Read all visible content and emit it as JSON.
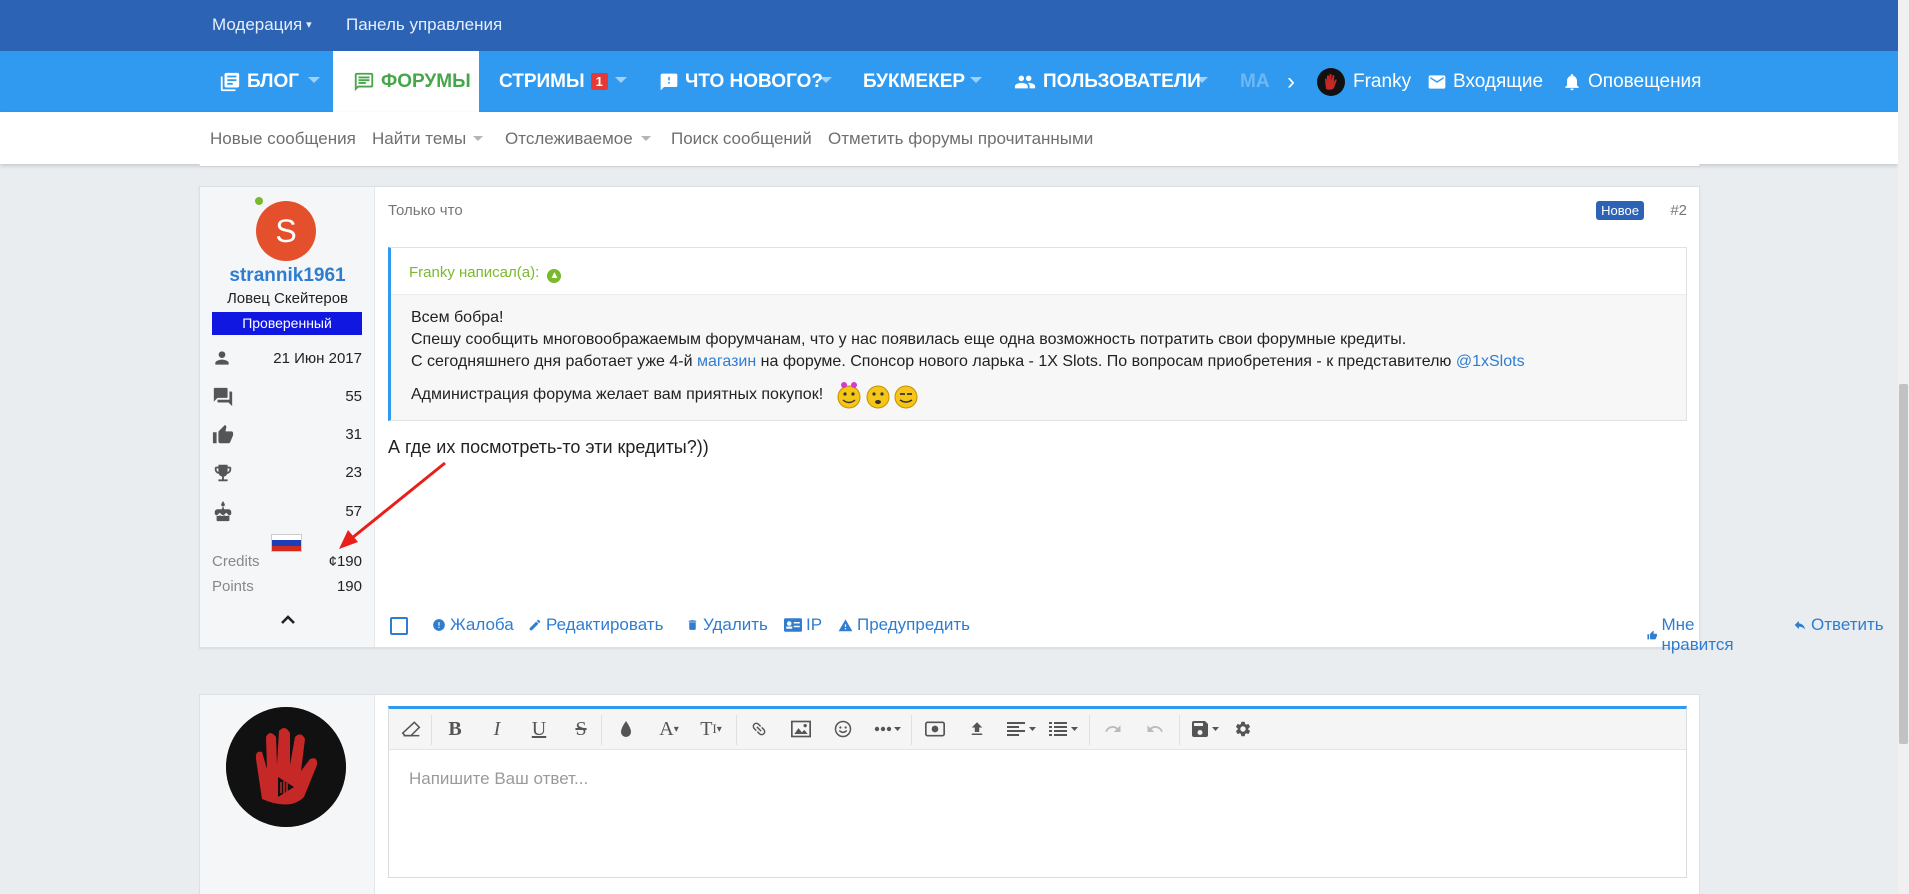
{
  "topbar": {
    "moderation": "Модерация",
    "control_panel": "Панель управления"
  },
  "nav": {
    "blog": "Блог",
    "forums": "Форумы",
    "streams": "Стримы",
    "streams_badge": "1",
    "whats_new": "Что нового?",
    "bookmaker": "Букмекер",
    "users": "Пользователи",
    "more_faded": "МА",
    "chevron": "›",
    "username": "Franky",
    "inbox": "Входящие",
    "alerts": "Оповещения"
  },
  "subnav": {
    "new_posts": "Новые сообщения",
    "find_threads": "Найти темы",
    "watched": "Отслеживаемое",
    "search_posts": "Поиск сообщений",
    "mark_read": "Отметить форумы прочитанными"
  },
  "post": {
    "user": {
      "avatar_letter": "S",
      "name": "strannik1961",
      "title": "Ловец Скейтеров",
      "banner": "Проверенный",
      "joined": "21 Июн 2017",
      "messages": "55",
      "likes": "31",
      "trophies": "23",
      "age": "57",
      "credits_label": "Credits",
      "credits_value": "¢190",
      "points_label": "Points",
      "points_value": "190"
    },
    "time": "Только что",
    "new_label": "Новое",
    "number": "#2",
    "quote": {
      "author": "Franky написал(а):",
      "line1": "Всем бобра!",
      "line2": "Спешу сообщить многовоображаемым форумчанам, что у нас появилась еще одна возможность потратить свои форумные кредиты.",
      "line3_a": "С сегодняшнего дня работает уже 4-й ",
      "line3_link": "магазин",
      "line3_b": " на форуме. Спонсор нового ларька - 1X Slots. По вопросам приобретения - к представителю ",
      "line3_mention": "@1xSlots",
      "line4": "Администрация форума желает вам приятных покупок!"
    },
    "message": "А где их посмотреть-то эти кредиты?))",
    "actions": {
      "report": "Жалоба",
      "edit": "Редактировать",
      "delete": "Удалить",
      "ip": "IP",
      "warn": "Предупредить",
      "like": "Мне нравится",
      "reply": "Ответить"
    }
  },
  "editor": {
    "placeholder": "Напишите Ваш ответ..."
  },
  "colors": {
    "topbar": "#2c63b5",
    "nav": "#2f9af0",
    "accent_green": "#47a64a",
    "link_blue": "#2f7dd1",
    "banner_blue": "#1017e0",
    "avatar_orange": "#e5502c",
    "annotation_red": "#e8201c"
  }
}
